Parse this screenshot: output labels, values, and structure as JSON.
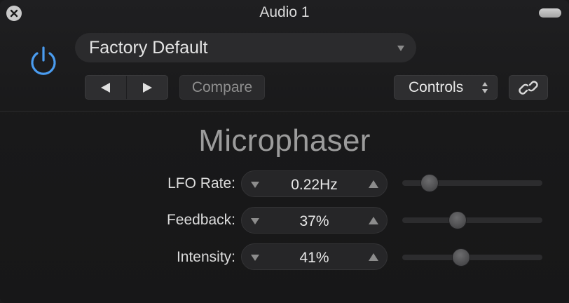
{
  "window": {
    "title": "Audio 1"
  },
  "preset": {
    "label": "Factory Default"
  },
  "toolbar": {
    "compare_label": "Compare",
    "view_label": "Controls"
  },
  "plugin": {
    "name": "Microphaser"
  },
  "params": [
    {
      "label": "LFO Rate:",
      "value": "0.22Hz",
      "slider_position": 0.15
    },
    {
      "label": "Feedback:",
      "value": "37%",
      "slider_position": 0.38
    },
    {
      "label": "Intensity:",
      "value": "41%",
      "slider_position": 0.41
    }
  ],
  "colors": {
    "power_accent": "#4a9cf0",
    "background": "#1a1a1b"
  },
  "icons": [
    "close-icon",
    "power-icon",
    "dropdown-arrow-icon",
    "previous-arrow-icon",
    "next-arrow-icon",
    "updown-arrows-icon",
    "link-icon",
    "decrement-arrow-icon",
    "increment-arrow-icon"
  ]
}
